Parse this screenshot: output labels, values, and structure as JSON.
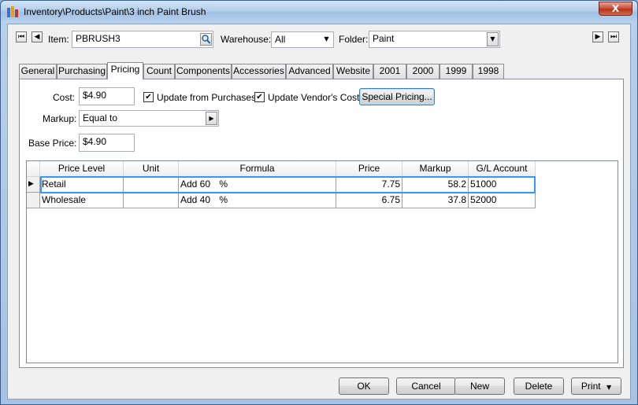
{
  "window": {
    "title": "Inventory\\Products\\Paint\\3 inch Paint Brush",
    "close_glyph": "X"
  },
  "header": {
    "item_label": "Item:",
    "item_value": "PBRUSH3",
    "warehouse_label": "Warehouse:",
    "warehouse_value": "All",
    "folder_label": "Folder:",
    "folder_value": "Paint"
  },
  "tabs": [
    "General",
    "Purchasing",
    "Pricing",
    "Count",
    "Components",
    "Accessories",
    "Advanced",
    "Website",
    "2001",
    "2000",
    "1999",
    "1998"
  ],
  "active_tab": "Pricing",
  "pricing": {
    "cost_label": "Cost:",
    "cost_value": "$4.90",
    "update_purchases_label": "Update from Purchases",
    "update_vendor_label": "Update Vendor's Cost",
    "special_pricing_label": "Special Pricing...",
    "markup_label": "Markup:",
    "markup_value": "Equal to",
    "base_price_label": "Base Price:",
    "base_price_value": "$4.90"
  },
  "grid": {
    "columns": [
      "Price Level",
      "Unit",
      "Formula",
      "Price",
      "Markup",
      "G/L Account"
    ],
    "rows": [
      {
        "price_level": "Retail",
        "unit": "",
        "formula": "Add 60",
        "formula_unit": "%",
        "price": "7.75",
        "markup": "58.2",
        "gl_account": "51000"
      },
      {
        "price_level": "Wholesale",
        "unit": "",
        "formula": "Add 40",
        "formula_unit": "%",
        "price": "6.75",
        "markup": "37.8",
        "gl_account": "52000"
      }
    ]
  },
  "footer": {
    "ok": "OK",
    "cancel": "Cancel",
    "new": "New",
    "delete": "Delete",
    "print": "Print"
  },
  "colors": {
    "selection_border": "#3399ff",
    "title_close": "#c94a30"
  }
}
